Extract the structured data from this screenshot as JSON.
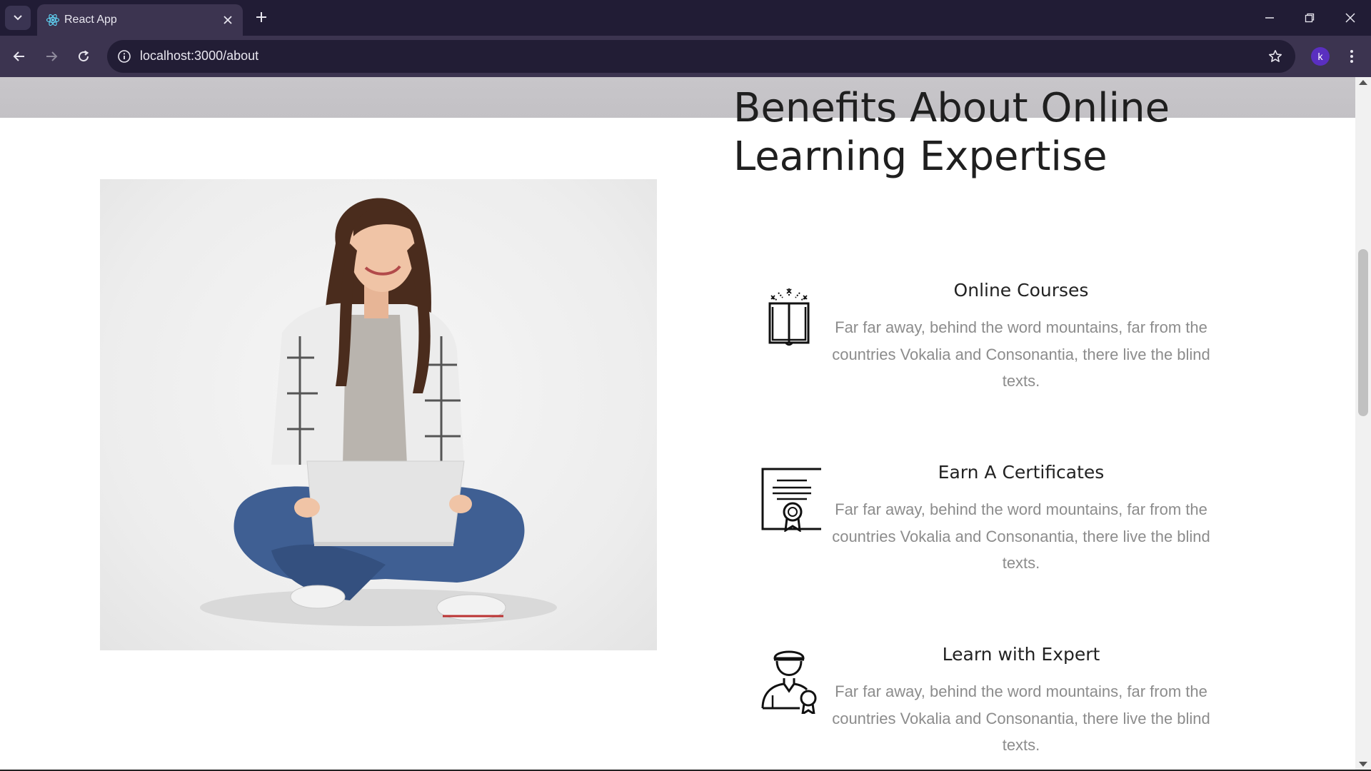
{
  "browser": {
    "tab_title": "React App",
    "url": "localhost:3000/about",
    "profile_initial": "k"
  },
  "page": {
    "heading": "Benefits About Online Learning Expertise",
    "benefits": [
      {
        "title": "Online Courses",
        "text": "Far far away, behind the word mountains, far from the countries Vokalia and Consonantia, there live the blind texts.",
        "icon": "open-book-icon"
      },
      {
        "title": "Earn A Certificates",
        "text": "Far far away, behind the word mountains, far from the countries Vokalia and Consonantia, there live the blind texts.",
        "icon": "certificate-icon"
      },
      {
        "title": "Learn with Expert",
        "text": "Far far away, behind the word mountains, far from the countries Vokalia and Consonantia, there live the blind texts.",
        "icon": "expert-icon"
      }
    ]
  },
  "colors": {
    "tabbar_bg": "#211c35",
    "toolbar_bg": "#3c3450",
    "heading": "#1f1f1f",
    "body_text": "#8c8c8c"
  }
}
